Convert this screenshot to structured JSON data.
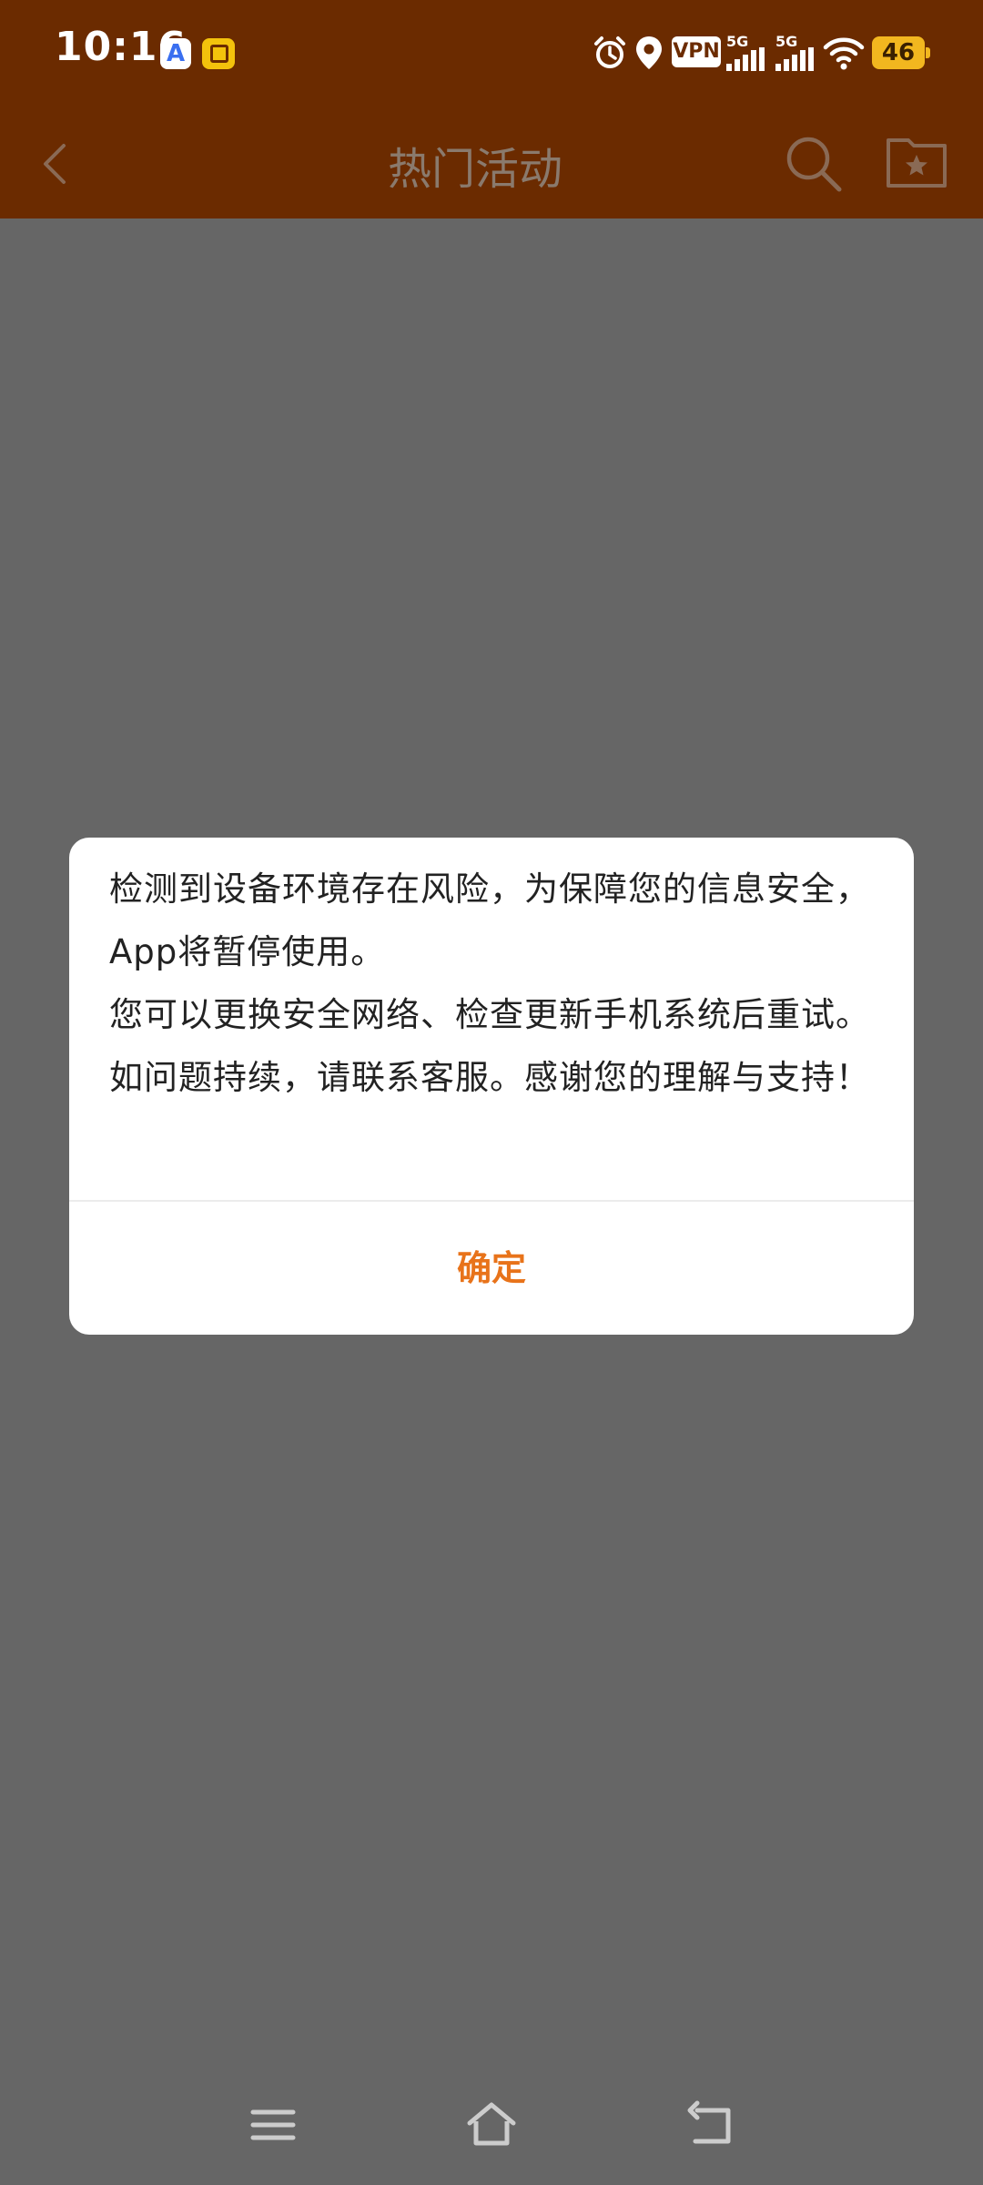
{
  "status_bar": {
    "time": "10:16",
    "app_icon_a_label": "A",
    "vpn_label": "VPN",
    "network_1": "5G",
    "network_2": "5G",
    "battery_level": "46",
    "icons": [
      "alarm-icon",
      "location-icon",
      "vpn-icon",
      "signal-icon",
      "signal-icon",
      "wifi-icon",
      "battery-icon"
    ]
  },
  "app_bar": {
    "title": "热门活动",
    "icons": [
      "back-icon",
      "search-icon",
      "favorites-folder-icon"
    ],
    "background_color": "#6b2b00"
  },
  "dialog": {
    "message_lines": [
      "检测到设备环境存在风险，为保障您的信息安全，App将暂停使用。",
      "您可以更换安全网络、检查更新手机系统后重试。如问题持续，请联系客服。感谢您的理解与支持！"
    ],
    "confirm_label": "确定",
    "accent_color": "#e8731a"
  },
  "nav_bar": {
    "icons": [
      "menu-icon",
      "home-icon",
      "back-nav-icon"
    ]
  }
}
